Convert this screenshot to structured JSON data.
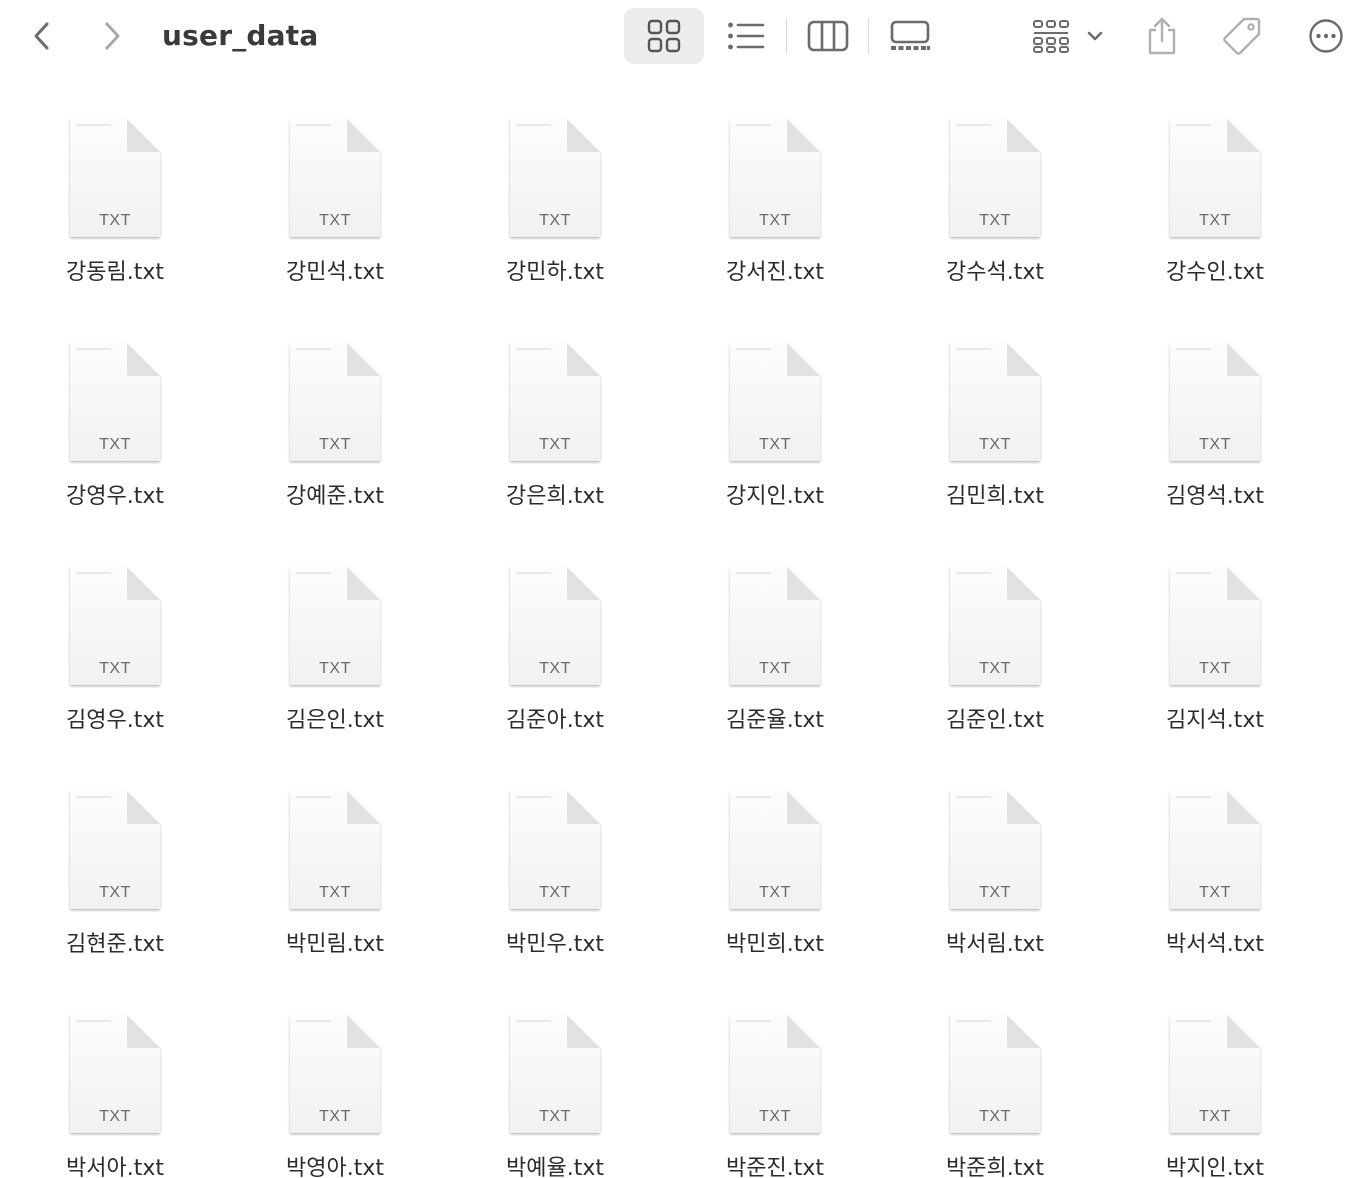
{
  "window": {
    "title": "user_data"
  },
  "toolbar": {
    "back_icon": "chevron-left-icon",
    "forward_icon": "chevron-right-icon",
    "views": [
      "view-icons",
      "view-list",
      "view-columns",
      "view-gallery"
    ],
    "active_view": "view-icons",
    "group_icon": "group-by-icon",
    "share_icon": "share-icon",
    "tag_icon": "tag-icon",
    "more_icon": "more-icon"
  },
  "files": [
    {
      "name": "강동림.txt",
      "ext": "TXT"
    },
    {
      "name": "강민석.txt",
      "ext": "TXT"
    },
    {
      "name": "강민하.txt",
      "ext": "TXT"
    },
    {
      "name": "강서진.txt",
      "ext": "TXT"
    },
    {
      "name": "강수석.txt",
      "ext": "TXT"
    },
    {
      "name": "강수인.txt",
      "ext": "TXT"
    },
    {
      "name": "강영우.txt",
      "ext": "TXT"
    },
    {
      "name": "강예준.txt",
      "ext": "TXT"
    },
    {
      "name": "강은희.txt",
      "ext": "TXT"
    },
    {
      "name": "강지인.txt",
      "ext": "TXT"
    },
    {
      "name": "김민희.txt",
      "ext": "TXT"
    },
    {
      "name": "김영석.txt",
      "ext": "TXT"
    },
    {
      "name": "김영우.txt",
      "ext": "TXT"
    },
    {
      "name": "김은인.txt",
      "ext": "TXT"
    },
    {
      "name": "김준아.txt",
      "ext": "TXT"
    },
    {
      "name": "김준율.txt",
      "ext": "TXT"
    },
    {
      "name": "김준인.txt",
      "ext": "TXT"
    },
    {
      "name": "김지석.txt",
      "ext": "TXT"
    },
    {
      "name": "김현준.txt",
      "ext": "TXT"
    },
    {
      "name": "박민림.txt",
      "ext": "TXT"
    },
    {
      "name": "박민우.txt",
      "ext": "TXT"
    },
    {
      "name": "박민희.txt",
      "ext": "TXT"
    },
    {
      "name": "박서림.txt",
      "ext": "TXT"
    },
    {
      "name": "박서석.txt",
      "ext": "TXT"
    },
    {
      "name": "박서아.txt",
      "ext": "TXT"
    },
    {
      "name": "박영아.txt",
      "ext": "TXT"
    },
    {
      "name": "박예율.txt",
      "ext": "TXT"
    },
    {
      "name": "박준진.txt",
      "ext": "TXT"
    },
    {
      "name": "박준희.txt",
      "ext": "TXT"
    },
    {
      "name": "박지인.txt",
      "ext": "TXT"
    }
  ]
}
